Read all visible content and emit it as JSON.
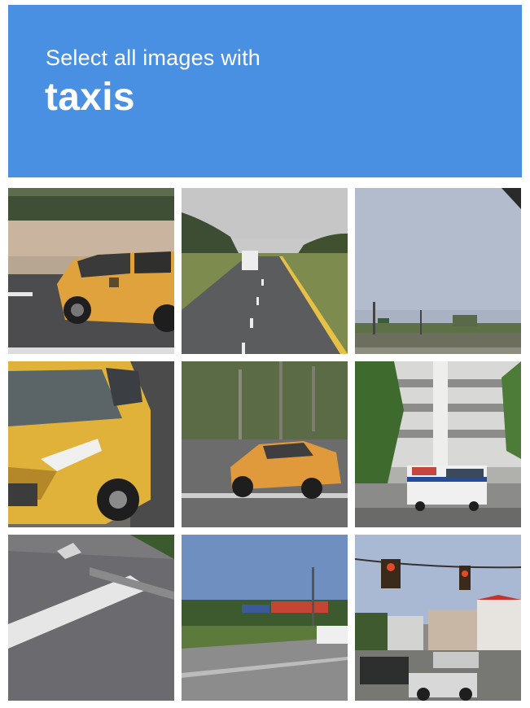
{
  "header": {
    "subtitle": "Select all images with",
    "target": "taxis",
    "background_color": "#4a90e2"
  },
  "tiles": [
    {
      "id": 1,
      "description_icon": "taxi-side-view-image"
    },
    {
      "id": 2,
      "description_icon": "highway-road-image"
    },
    {
      "id": 3,
      "description_icon": "sky-intersection-image"
    },
    {
      "id": 4,
      "description_icon": "minivan-taxi-closeup-image"
    },
    {
      "id": 5,
      "description_icon": "taxi-parking-lot-image"
    },
    {
      "id": 6,
      "description_icon": "bus-parking-garage-image"
    },
    {
      "id": 7,
      "description_icon": "road-marking-image"
    },
    {
      "id": 8,
      "description_icon": "street-storefronts-image"
    },
    {
      "id": 9,
      "description_icon": "traffic-light-intersection-image"
    }
  ]
}
